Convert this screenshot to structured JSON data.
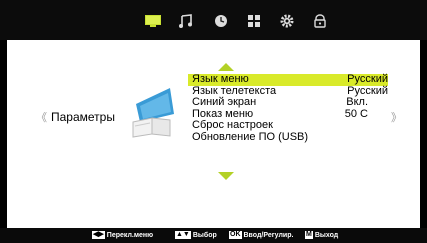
{
  "tabs": [
    {
      "icon": "picture-icon"
    },
    {
      "icon": "music-note-icon"
    },
    {
      "icon": "clock-icon"
    },
    {
      "icon": "grid-icon"
    },
    {
      "icon": "gear-icon"
    },
    {
      "icon": "lock-icon"
    }
  ],
  "nav": {
    "left_label": "Параметры",
    "left_chevron": "《",
    "right_chevron": "》"
  },
  "menu": {
    "items": [
      {
        "label": "Язык меню",
        "value": "Русский",
        "selected": true
      },
      {
        "label": "Язык телетекста",
        "value": "Русский"
      },
      {
        "label": "Синий экран",
        "value": "Вкл."
      },
      {
        "label": "Показ меню",
        "value": "50 С"
      },
      {
        "label": "Сброс настроек",
        "value": ""
      },
      {
        "label": "Обновление ПО (USB)",
        "value": ""
      }
    ]
  },
  "footer": {
    "items": [
      {
        "key": "◀▶",
        "label": "Перекл.меню"
      },
      {
        "key": "▲▼",
        "label": "Выбор"
      },
      {
        "key": "OK",
        "label": "Ввод/Регулир."
      },
      {
        "key": "M",
        "label": "Выход"
      }
    ]
  },
  "colors": {
    "highlight": "#d9ea2a",
    "arrow": "#b3d126",
    "panel": "#ffffff",
    "topbar": "#0c0c0c"
  }
}
